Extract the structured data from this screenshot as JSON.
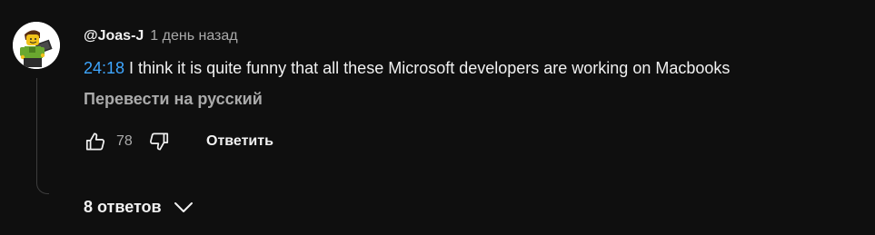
{
  "comment": {
    "author": "@Joas-J",
    "time_ago": "1 день назад",
    "timestamp_link": "24:18",
    "text": " I think it is quite funny that all these Microsoft developers are working on Macbooks",
    "translate_label": "Перевести на русский",
    "like_count": "78",
    "reply_label": "Ответить",
    "replies_label": "8 ответов",
    "avatar_icon": "lego-figure-avatar",
    "like_icon": "thumbs-up-icon",
    "dislike_icon": "thumbs-down-icon",
    "expand_icon": "chevron-down-icon"
  },
  "colors": {
    "background": "#0f0f0f",
    "text_primary": "#f1f1f1",
    "text_secondary": "#aaaaaa",
    "link": "#3ea6ff"
  }
}
